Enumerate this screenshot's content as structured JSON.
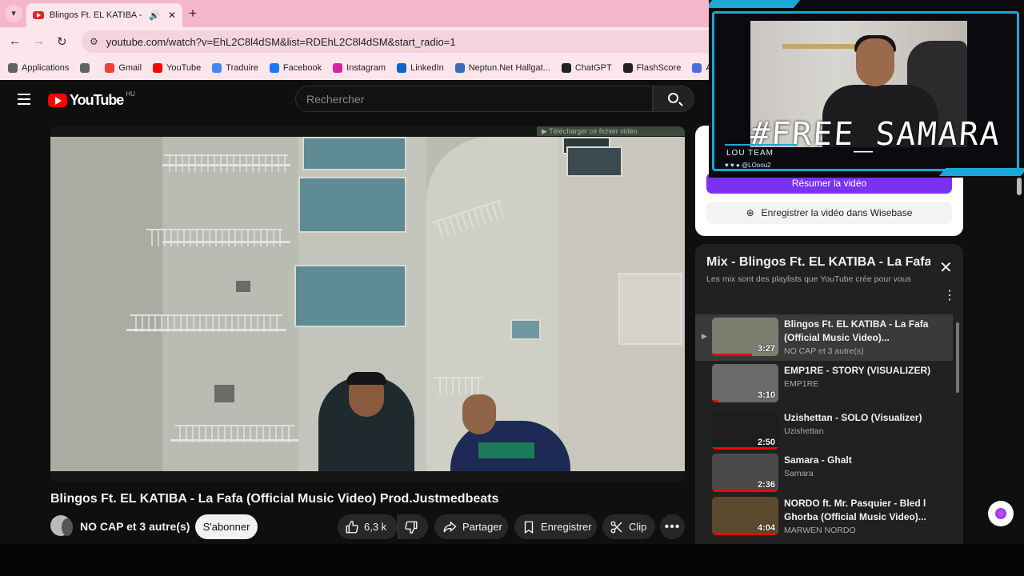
{
  "browser": {
    "tab_title": "Blingos Ft. EL KATIBA - La Fafa",
    "url": "youtube.com/watch?v=EhL2C8l4dSM&list=RDEhL2C8l4dSM&start_radio=1",
    "bookmarks": [
      {
        "label": "Applications",
        "color": "#5f6368"
      },
      {
        "label": "",
        "color": "#5f6368"
      },
      {
        "label": "Gmail",
        "color": "#ea4335"
      },
      {
        "label": "YouTube",
        "color": "#ff0000"
      },
      {
        "label": "Traduire",
        "color": "#4285f4"
      },
      {
        "label": "Facebook",
        "color": "#1877f2"
      },
      {
        "label": "Instagram",
        "color": "#d6249f"
      },
      {
        "label": "LinkedIn",
        "color": "#0a66c2"
      },
      {
        "label": "Neptun.Net Hallgat...",
        "color": "#3b6db3"
      },
      {
        "label": "ChatGPT",
        "color": "#222222"
      },
      {
        "label": "FlashScore",
        "color": "#222222"
      },
      {
        "label": "Accueil -",
        "color": "#4a6ee0"
      }
    ]
  },
  "youtube": {
    "logo_text": "YouTube",
    "country_code": "HU",
    "search_placeholder": "Rechercher"
  },
  "video": {
    "download_bar": "▶ Télécharger ce fichier vidéo",
    "title": "Blingos Ft. EL KATIBA - La Fafa (Official Music Video) Prod.Justmedbeats",
    "channel": "NO CAP et 3 autre(s)",
    "subscribe_label": "S'abonner",
    "like_count": "6,3 k",
    "share_label": "Partager",
    "save_label": "Enregistrer",
    "clip_label": "Clip"
  },
  "extension": {
    "summarize_label": "Résumer la vidéo",
    "wisebase_label": "Enregistrer la vidéo dans Wisebase"
  },
  "mix": {
    "title": "Mix - Blingos Ft. EL KATIBA - La Fafa (Official Music Video) Prod.Justmedbeats",
    "subtitle": "Les mix sont des playlists que YouTube crée pour vous",
    "items": [
      {
        "title": "Blingos Ft. EL KATIBA - La Fafa (Official Music Video)...",
        "author": "NO CAP et 3 autre(s)",
        "duration": "3:27",
        "active": true,
        "progress": 0.6,
        "thumb": "#7c7f70"
      },
      {
        "title": "EMP1RE - STORY (VISUALIZER)",
        "author": "EMP1RE",
        "duration": "3:10",
        "active": false,
        "progress": 0.1,
        "thumb": "#6a6a6a"
      },
      {
        "title": "Uzishettan - SOLO (Visualizer)",
        "author": "Uzishettan",
        "duration": "2:50",
        "active": false,
        "progress": 1.0,
        "thumb": "#1e1e1e"
      },
      {
        "title": "Samara - Ghalt",
        "author": "Samara",
        "duration": "2:36",
        "active": false,
        "progress": 1.0,
        "thumb": "#4b4a48"
      },
      {
        "title": "NORDO ft. Mr. Pasquier - Bled l Ghorba (Official Music Video)...",
        "author": "MARWEN NORDO",
        "duration": "4:04",
        "active": false,
        "progress": 1.0,
        "thumb": "#5b4a2f"
      }
    ]
  },
  "webcam": {
    "overlay_text": "#FREE_SAMARA",
    "team_text": "LOU TEAM",
    "handle": "@LOoou2"
  }
}
